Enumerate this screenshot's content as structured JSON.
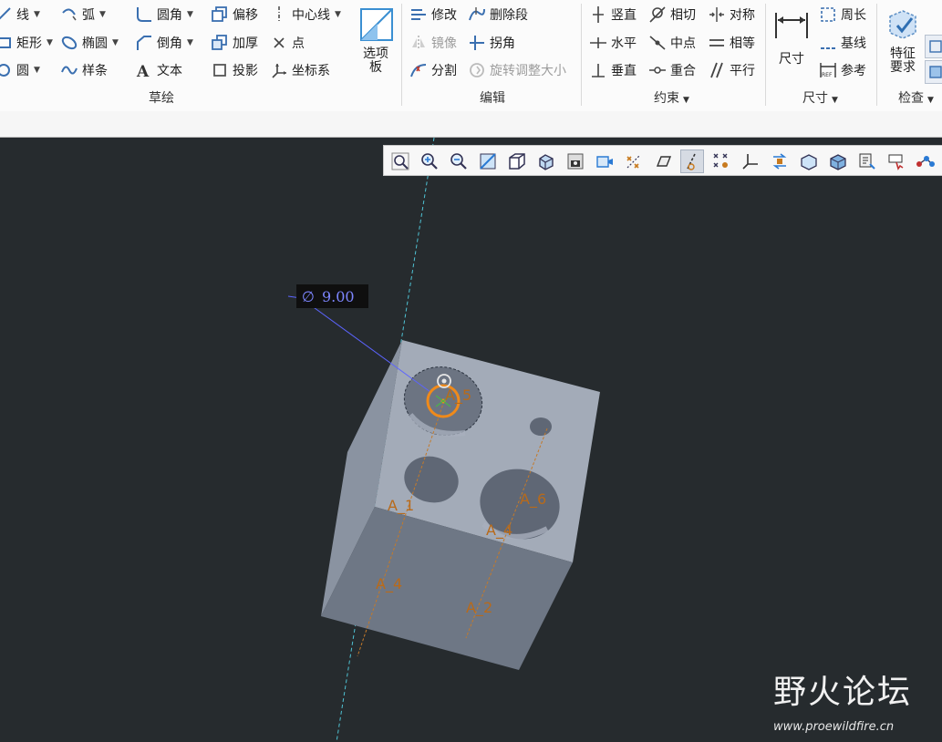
{
  "ribbon": {
    "sketch": {
      "line": "线",
      "arc": "弧",
      "fillet": "圆角",
      "offset": "偏移",
      "centerline": "中心线",
      "rectangle": "矩形",
      "ellipse": "椭圆",
      "chamfer": "倒角",
      "thicken": "加厚",
      "point": "点",
      "circle": "圆",
      "spline": "样条",
      "text": "文本",
      "project": "投影",
      "coord_sys": "坐标系",
      "palette": "选项板",
      "group_label": "草绘"
    },
    "edit": {
      "modify": "修改",
      "delete_segment": "删除段",
      "mirror": "镜像",
      "corner": "拐角",
      "divide": "分割",
      "rotate_resize": "旋转调整大小",
      "group_label": "编辑"
    },
    "constrain": {
      "vertical": "竖直",
      "tangent": "相切",
      "symmetric": "对称",
      "horizontal": "水平",
      "midpoint": "中点",
      "equal": "相等",
      "perpendicular": "垂直",
      "coincident": "重合",
      "parallel": "平行",
      "group_label": "约束"
    },
    "dimension": {
      "dimension": "尺寸",
      "perimeter": "周长",
      "baseline": "基线",
      "reference": "参考",
      "group_label": "尺寸"
    },
    "inspect": {
      "feature_req": "特征要求",
      "group_label": "检查"
    }
  },
  "viewport": {
    "dim_symbol": "∅",
    "dim_value": "9.00",
    "axes": [
      "A_5",
      "A_1",
      "A_6",
      "A_4",
      "A_4",
      "A_2"
    ],
    "background": "#262b2e",
    "part_color": "#a3abb8"
  },
  "watermark": {
    "cn": "野火论坛",
    "url": "www.proewildfire.cn"
  }
}
